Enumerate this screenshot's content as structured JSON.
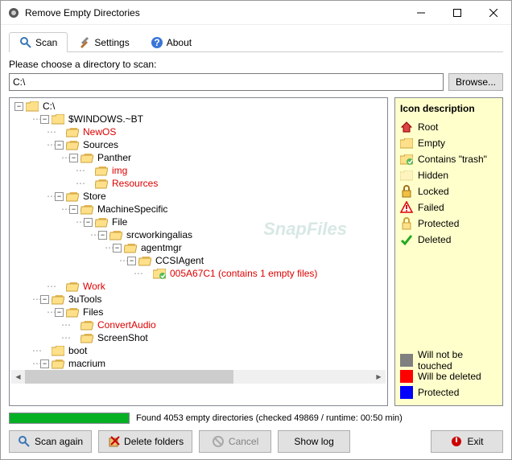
{
  "window": {
    "title": "Remove Empty Directories"
  },
  "tabs": {
    "scan": "Scan",
    "settings": "Settings",
    "about": "About"
  },
  "directory": {
    "label": "Please choose a directory to scan:",
    "value": "C:\\",
    "browse_label": "Browse..."
  },
  "tree": {
    "root": "C:\\",
    "nodes": [
      {
        "indent": 0,
        "toggle": "-",
        "label": "C:\\",
        "color": "normal",
        "icon": "folder"
      },
      {
        "indent": 1,
        "toggle": "-",
        "label": "$WINDOWS.~BT",
        "color": "normal",
        "icon": "folder"
      },
      {
        "indent": 2,
        "toggle": null,
        "label": "NewOS",
        "color": "red",
        "icon": "folder-open"
      },
      {
        "indent": 2,
        "toggle": "-",
        "label": "Sources",
        "color": "normal",
        "icon": "folder-open"
      },
      {
        "indent": 3,
        "toggle": "-",
        "label": "Panther",
        "color": "normal",
        "icon": "folder-open"
      },
      {
        "indent": 4,
        "toggle": null,
        "label": "img",
        "color": "red",
        "icon": "folder-open"
      },
      {
        "indent": 4,
        "toggle": null,
        "label": "Resources",
        "color": "red",
        "icon": "folder-open"
      },
      {
        "indent": 2,
        "toggle": "-",
        "label": "Store",
        "color": "normal",
        "icon": "folder-open"
      },
      {
        "indent": 3,
        "toggle": "-",
        "label": "MachineSpecific",
        "color": "normal",
        "icon": "folder-open"
      },
      {
        "indent": 4,
        "toggle": "-",
        "label": "File",
        "color": "normal",
        "icon": "folder-open"
      },
      {
        "indent": 5,
        "toggle": "-",
        "label": "srcworkingalias",
        "color": "normal",
        "icon": "folder-open"
      },
      {
        "indent": 6,
        "toggle": "-",
        "label": "agentmgr",
        "color": "normal",
        "icon": "folder-open"
      },
      {
        "indent": 7,
        "toggle": "-",
        "label": "CCSIAgent",
        "color": "normal",
        "icon": "folder-open"
      },
      {
        "indent": 8,
        "toggle": null,
        "label": "005A67C1 (contains 1 empty files)",
        "color": "red",
        "icon": "folder-trash"
      },
      {
        "indent": 2,
        "toggle": null,
        "label": "Work",
        "color": "red",
        "icon": "folder-open"
      },
      {
        "indent": 1,
        "toggle": "-",
        "label": "3uTools",
        "color": "normal",
        "icon": "folder-open"
      },
      {
        "indent": 2,
        "toggle": "-",
        "label": "Files",
        "color": "normal",
        "icon": "folder-open"
      },
      {
        "indent": 3,
        "toggle": null,
        "label": "ConvertAudio",
        "color": "red",
        "icon": "folder-open"
      },
      {
        "indent": 3,
        "toggle": null,
        "label": "ScreenShot",
        "color": "normal",
        "icon": "folder-open"
      },
      {
        "indent": 1,
        "toggle": null,
        "label": "boot",
        "color": "normal",
        "icon": "folder"
      },
      {
        "indent": 1,
        "toggle": "-",
        "label": "macrium",
        "color": "normal",
        "icon": "folder-open"
      }
    ]
  },
  "legend": {
    "title": "Icon description",
    "items": [
      {
        "label": "Root",
        "icon": "root"
      },
      {
        "label": "Empty",
        "icon": "empty"
      },
      {
        "label": "Contains \"trash\"",
        "icon": "trash"
      },
      {
        "label": "Hidden",
        "icon": "hidden"
      },
      {
        "label": "Locked",
        "icon": "locked"
      },
      {
        "label": "Failed",
        "icon": "failed"
      },
      {
        "label": "Protected",
        "icon": "protected"
      },
      {
        "label": "Deleted",
        "icon": "deleted"
      }
    ],
    "color_legend": [
      {
        "color": "#808080",
        "label": "Will not be touched"
      },
      {
        "color": "#ff0000",
        "label": "Will be deleted"
      },
      {
        "color": "#0000ff",
        "label": "Protected"
      }
    ]
  },
  "status": {
    "text": "Found 4053 empty directories (checked 49869 / runtime: 00:50 min)"
  },
  "buttons": {
    "scan_again": "Scan again",
    "delete_folders": "Delete folders",
    "cancel": "Cancel",
    "show_log": "Show log",
    "exit": "Exit"
  }
}
